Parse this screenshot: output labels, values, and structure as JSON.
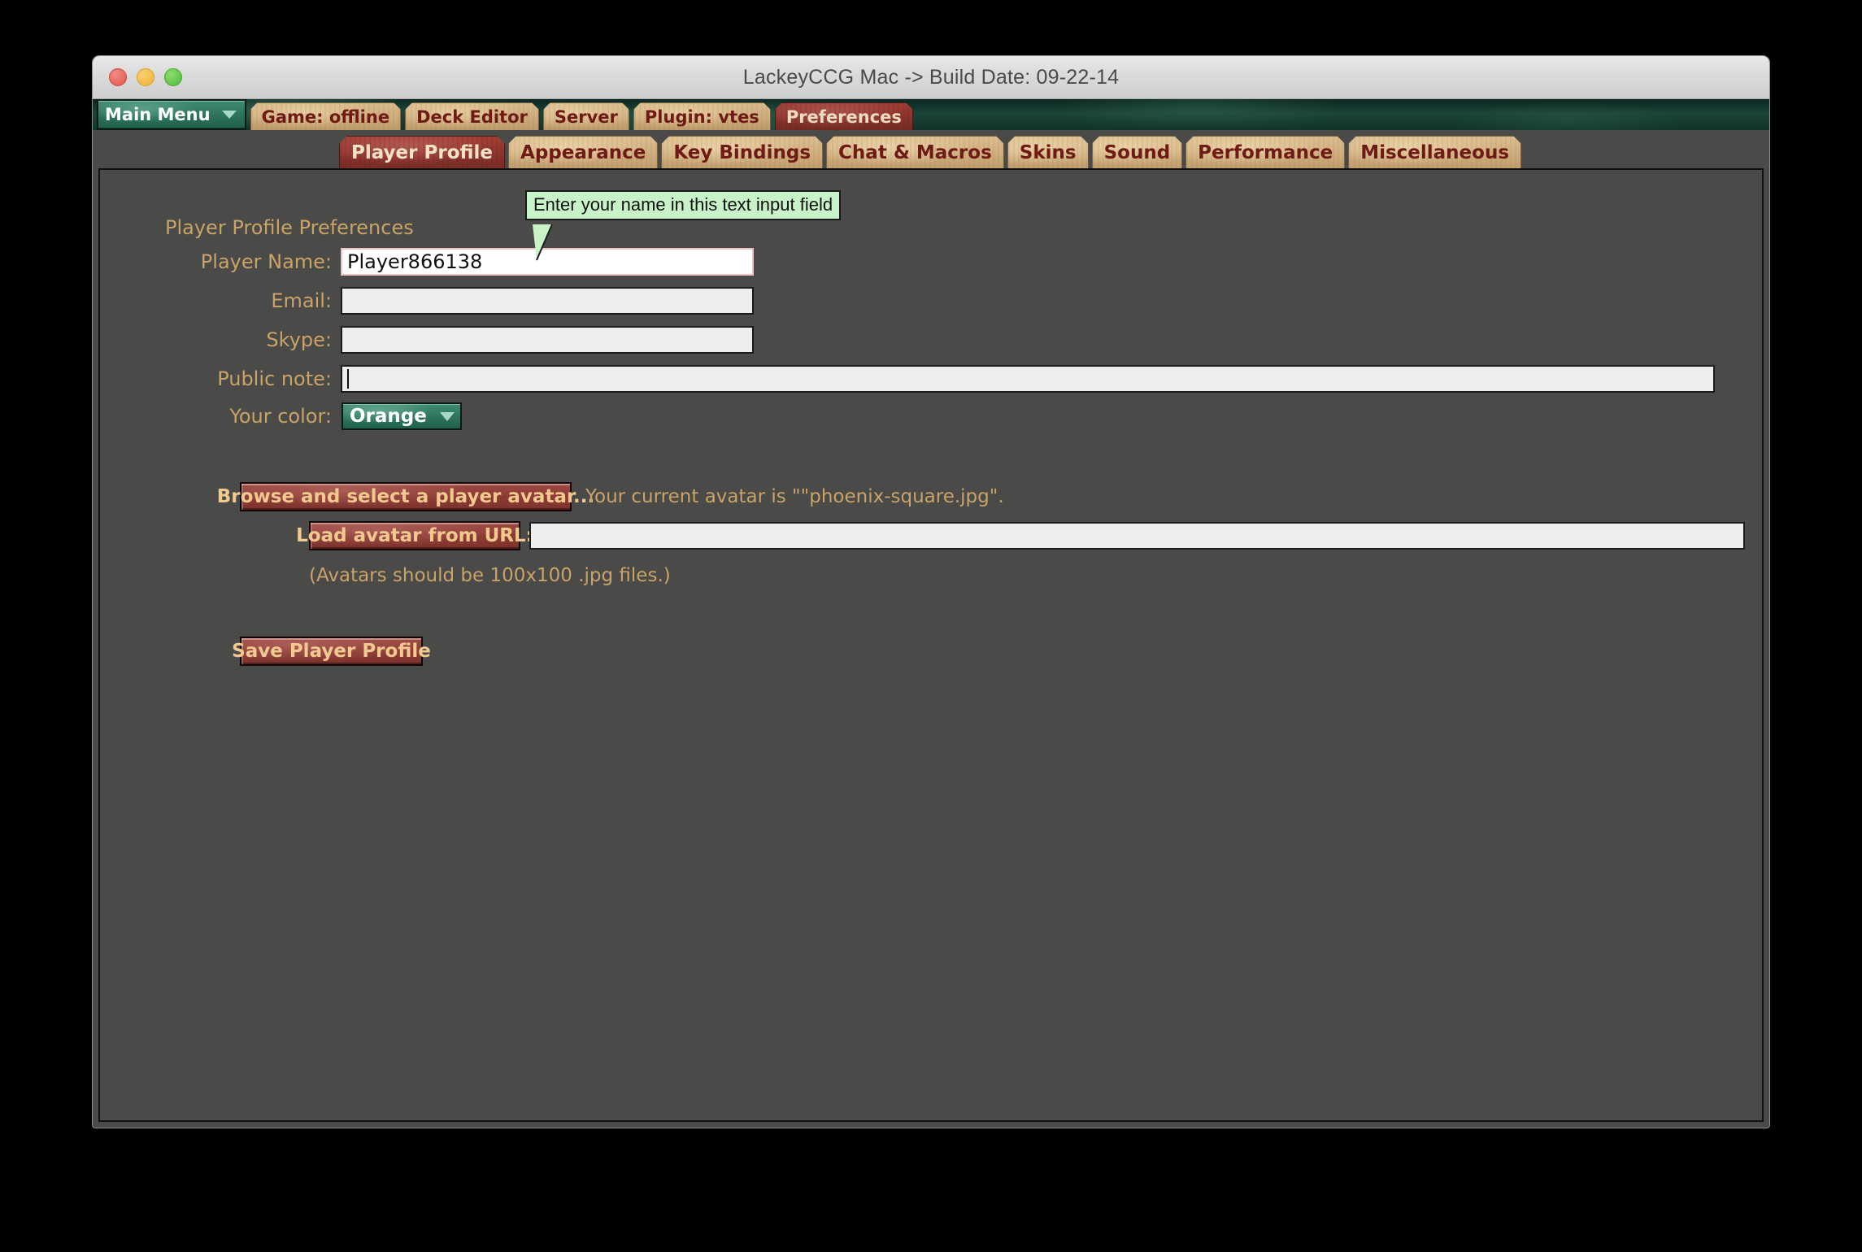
{
  "window": {
    "title": "LackeyCCG Mac -> Build Date: 09-22-14",
    "traffic_lights": {
      "close_color": "#e0554e",
      "minimize_color": "#eeb030",
      "maximize_color": "#4cbb38"
    }
  },
  "menubar": {
    "main_menu_label": "Main Menu",
    "items": [
      {
        "label": "Game: offline",
        "active": false
      },
      {
        "label": "Deck Editor",
        "active": false
      },
      {
        "label": "Server",
        "active": false
      },
      {
        "label": "Plugin: vtes",
        "active": false
      },
      {
        "label": "Preferences",
        "active": true
      }
    ]
  },
  "subtabs": [
    {
      "label": "Player Profile",
      "active": true
    },
    {
      "label": "Appearance",
      "active": false
    },
    {
      "label": "Key Bindings",
      "active": false
    },
    {
      "label": "Chat & Macros",
      "active": false
    },
    {
      "label": "Skins",
      "active": false
    },
    {
      "label": "Sound",
      "active": false
    },
    {
      "label": "Performance",
      "active": false
    },
    {
      "label": "Miscellaneous",
      "active": false
    }
  ],
  "form": {
    "section_title": "Player Profile Preferences",
    "player_name": {
      "label": "Player Name:",
      "value": "Player866138"
    },
    "email": {
      "label": "Email:",
      "value": ""
    },
    "skype": {
      "label": "Skype:",
      "value": ""
    },
    "public_note": {
      "label": "Public note:",
      "value": ""
    },
    "your_color": {
      "label": "Your color:",
      "value": "Orange",
      "options": [
        "Orange"
      ]
    }
  },
  "avatar": {
    "browse_button": "Browse and select a player avatar...",
    "current_avatar_text": "Your current avatar is \"\"phoenix-square.jpg\".",
    "load_url_button": "Load avatar from URL:",
    "url_value": "",
    "hint": "(Avatars should be 100x100 .jpg files.)"
  },
  "actions": {
    "save_button": "Save Player Profile"
  },
  "tooltip": {
    "text": "Enter your name in this text input field",
    "background": "#c8f2c8"
  },
  "colors": {
    "panel_background": "#4a4a48",
    "label_gold": "#c9a367",
    "tab_wood": "#cfad7d",
    "tab_active_red": "#8e342c",
    "dropdown_teal": "#2e7560",
    "button_maroon": "#8e3b35"
  }
}
